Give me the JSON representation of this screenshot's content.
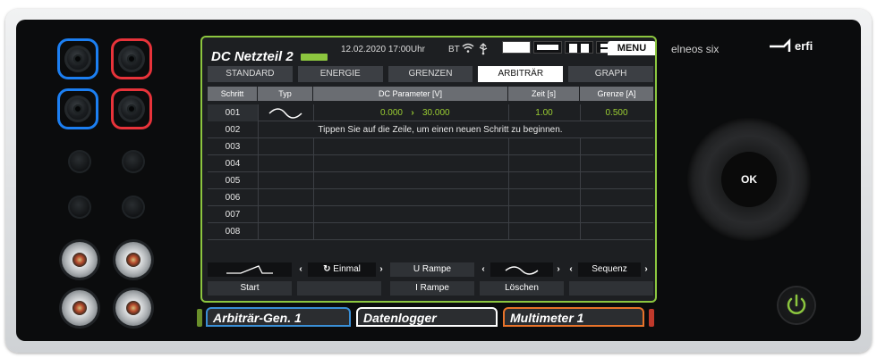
{
  "device": {
    "model_label": "elneos six",
    "brand_logo_text": "erfi",
    "ok_label": "OK",
    "power_icon": "power-icon"
  },
  "screen": {
    "title": "DC Netzteil 2",
    "status_indicator_color": "#8cc63f",
    "datetime": "12.02.2020  17:00Uhr",
    "bt_label": "BT",
    "menu_label": "MENU",
    "tabs": [
      {
        "label": "STANDARD",
        "active": false
      },
      {
        "label": "ENERGIE",
        "active": false
      },
      {
        "label": "GRENZEN",
        "active": false
      },
      {
        "label": "ARBITRÄR",
        "active": true
      },
      {
        "label": "GRAPH",
        "active": false
      }
    ],
    "table": {
      "headers": {
        "step": "Schritt",
        "type": "Typ",
        "param": "DC Parameter [V]",
        "time": "Zeit [s]",
        "limit": "Grenze [A]"
      },
      "rows": [
        {
          "step": "001",
          "type_icon": "sine-wave-icon",
          "from": "0.000",
          "to": "30.000",
          "time": "1.00",
          "limit": "0.500"
        },
        {
          "step": "002",
          "hint": "Tippen Sie auf die Zeile, um einen neuen Schritt zu beginnen."
        },
        {
          "step": "003"
        },
        {
          "step": "004"
        },
        {
          "step": "005"
        },
        {
          "step": "006"
        },
        {
          "step": "007"
        },
        {
          "step": "008"
        }
      ]
    },
    "controls_top": {
      "ramp_icon": "ramp-icon",
      "mode_value": "Einmal",
      "u_rampe": "U Rampe",
      "wave_icon": "sine-wave-icon",
      "sequence": "Sequenz"
    },
    "controls_bottom": {
      "start": "Start",
      "i_rampe": "I Rampe",
      "loeschen": "Löschen"
    }
  },
  "bottom_tabs": [
    {
      "label": "Arbiträr-Gen. 1",
      "color": "#3a8fd6"
    },
    {
      "label": "Datenlogger",
      "color": "#ffffff"
    },
    {
      "label": "Multimeter 1",
      "color": "#e8732a"
    }
  ]
}
